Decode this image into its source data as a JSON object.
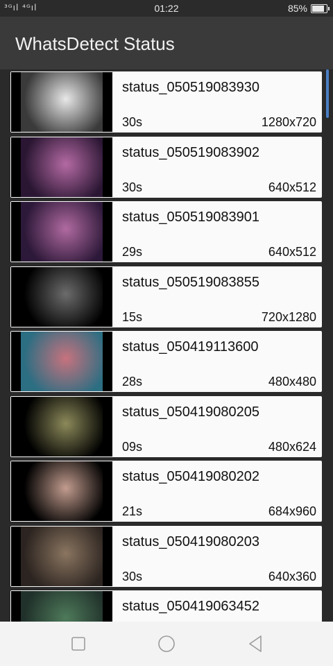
{
  "status_bar": {
    "signal": "³ᴳıl ⁴ᴳıl",
    "time": "01:22",
    "battery": "85%",
    "battery_level": 0.85
  },
  "app_bar": {
    "title": "WhatsDetect Status"
  },
  "items": [
    {
      "name": "status_050519083930",
      "duration": "30s",
      "resolution": "1280x720",
      "thumb_colors": [
        "#e8e8e8",
        "#3a3a3a"
      ]
    },
    {
      "name": "status_050519083902",
      "duration": "30s",
      "resolution": "640x512",
      "thumb_colors": [
        "#b46aa3",
        "#2a1633"
      ]
    },
    {
      "name": "status_050519083901",
      "duration": "29s",
      "resolution": "640x512",
      "thumb_colors": [
        "#b06aa0",
        "#2c1838"
      ]
    },
    {
      "name": "status_050519083855",
      "duration": "15s",
      "resolution": "720x1280",
      "thumb_colors": [
        "#6c6c6c",
        "#000000"
      ]
    },
    {
      "name": "status_050419113600",
      "duration": "28s",
      "resolution": "480x480",
      "thumb_colors": [
        "#c7727e",
        "#2c6e82"
      ]
    },
    {
      "name": "status_050419080205",
      "duration": "09s",
      "resolution": "480x624",
      "thumb_colors": [
        "#8c8a5a",
        "#000000"
      ]
    },
    {
      "name": "status_050419080202",
      "duration": "21s",
      "resolution": "684x960",
      "thumb_colors": [
        "#c29c8e",
        "#000000"
      ]
    },
    {
      "name": "status_050419080203",
      "duration": "30s",
      "resolution": "640x360",
      "thumb_colors": [
        "#8a7560",
        "#2c2420"
      ]
    },
    {
      "name": "status_050419063452",
      "duration": "",
      "resolution": "",
      "thumb_colors": [
        "#4e7a5a",
        "#20302a"
      ]
    }
  ],
  "nav": {
    "recent": "square-icon",
    "home": "circle-icon",
    "back": "triangle-icon"
  }
}
